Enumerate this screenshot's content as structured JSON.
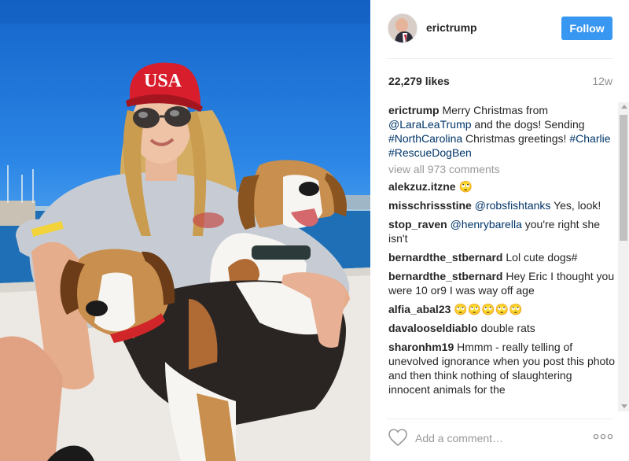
{
  "post": {
    "username": "erictrump",
    "follow_label": "Follow",
    "likes": "22,279 likes",
    "age": "12w",
    "caption": {
      "username": "erictrump",
      "t1": " Merry Christmas from ",
      "m1": "@LaraLeaTrump",
      "t2": " and the dogs! Sending ",
      "h1": "#NorthCarolina",
      "t3": " Christmas greetings! ",
      "h2": "#Charlie",
      "t4": " ",
      "h3": "#RescueDogBen"
    },
    "view_all": "view all 973 comments",
    "add_comment_placeholder": "Add a comment…",
    "hat_text": "USA"
  },
  "comments": [
    {
      "user": "alekzuz.itzne",
      "text": " 🙄"
    },
    {
      "user": "misschrissstine",
      "mention": "@robsfishtanks",
      "text": " Yes, look!"
    },
    {
      "user": "stop_raven",
      "mention": "@henrybarella",
      "text": " you're right she isn't"
    },
    {
      "user": "bernardthe_stbernard",
      "text": " Lol cute dogs#"
    },
    {
      "user": "bernardthe_stbernard",
      "text": " Hey Eric I thought you were 10 or9 I was way off age"
    },
    {
      "user": "alfia_abal23",
      "text": " 🙄🙄🙄🙄🙄"
    },
    {
      "user": "davalooseldiablo",
      "text": " double rats"
    },
    {
      "user": "sharonhm19",
      "text": " Hmmm - really telling of unevolved ignorance when you post this photo and then think nothing of slaughtering innocent animals for the"
    }
  ],
  "colors": {
    "follow": "#3897f0",
    "link": "#003569",
    "hat": "#d81e2c"
  }
}
